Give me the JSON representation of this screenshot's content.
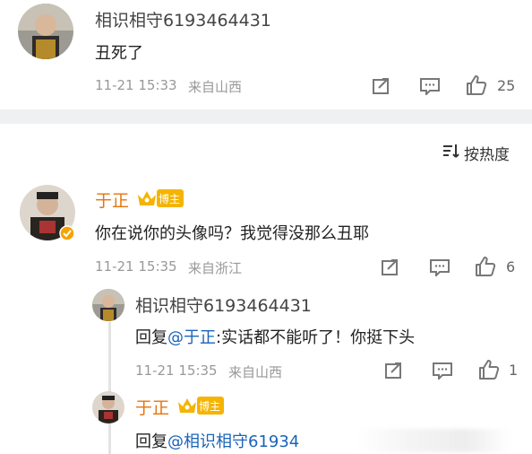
{
  "comment1": {
    "username": "相识相守6193464431",
    "text": "丑死了",
    "time": "11-21 15:33",
    "location": "来自山西",
    "likes": "25"
  },
  "sort": {
    "label": "按热度"
  },
  "comment2": {
    "username": "于正",
    "badge": "博主",
    "text": "你在说你的头像吗？我觉得没那么丑耶",
    "time": "11-21 15:35",
    "location": "来自浙江",
    "likes": "6"
  },
  "reply1": {
    "username": "相识相守6193464431",
    "prefix": "回复",
    "mention": "@于正",
    "text": ":实话都不能听了！你挺下头",
    "time": "11-21 15:35",
    "location": "来自山西",
    "likes": "1"
  },
  "reply2": {
    "username": "于正",
    "badge": "博主",
    "prefix": "回复",
    "mention": "@相识相守61934",
    "text": ""
  },
  "icons": [
    "share-icon",
    "comment-icon",
    "like-icon",
    "sort-icon",
    "crown-icon",
    "verified-icon"
  ]
}
